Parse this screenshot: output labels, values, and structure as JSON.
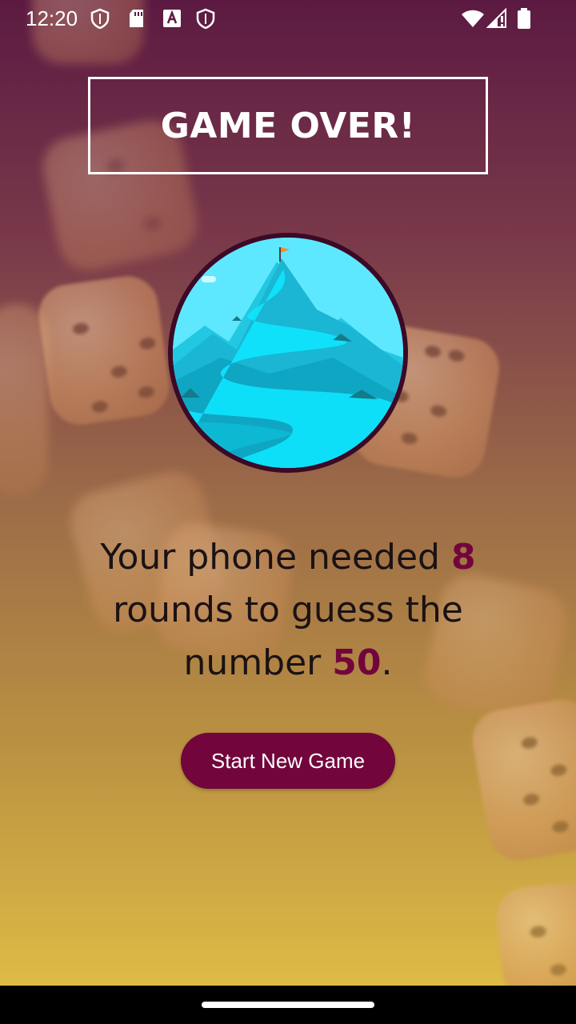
{
  "status_bar": {
    "time": "12:20",
    "left_icons": [
      "shield-icon",
      "sd-card-icon",
      "font-a-icon",
      "shield-icon"
    ],
    "right_icons": [
      "wifi-icon",
      "cellular-signal-icon",
      "battery-icon"
    ]
  },
  "title": "GAME OVER!",
  "summary": {
    "prefix": "Your phone needed",
    "rounds": "8",
    "middle": "rounds to guess the number",
    "number": "50",
    "suffix": "."
  },
  "button": {
    "label": "Start New Game"
  },
  "colors": {
    "accent": "#72063c",
    "image_border": "#3b0a27",
    "gradient_top": "#5c1a42",
    "gradient_bottom": "#ddbb45"
  }
}
